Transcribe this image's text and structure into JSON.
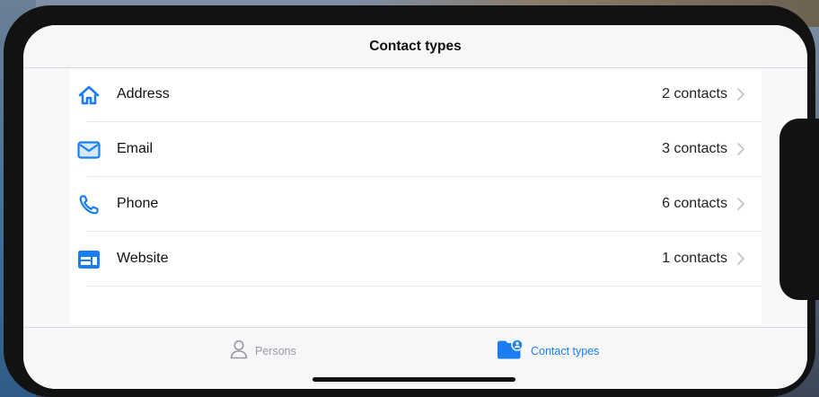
{
  "navbar": {
    "title": "Contact types"
  },
  "rows": [
    {
      "label": "Address",
      "count": "2 contacts",
      "icon": "house-icon"
    },
    {
      "label": "Email",
      "count": "3 contacts",
      "icon": "envelope-icon"
    },
    {
      "label": "Phone",
      "count": "6 contacts",
      "icon": "phone-icon"
    },
    {
      "label": "Website",
      "count": "1 contacts",
      "icon": "browser-window-icon"
    }
  ],
  "tabbar": {
    "tabs": [
      {
        "label": "Persons",
        "icon": "person-icon",
        "selected": false
      },
      {
        "label": "Contact types",
        "icon": "folder-person-icon",
        "selected": true
      }
    ]
  },
  "colors": {
    "accent": "#1a7df2",
    "inactive": "#9b9b9f"
  }
}
